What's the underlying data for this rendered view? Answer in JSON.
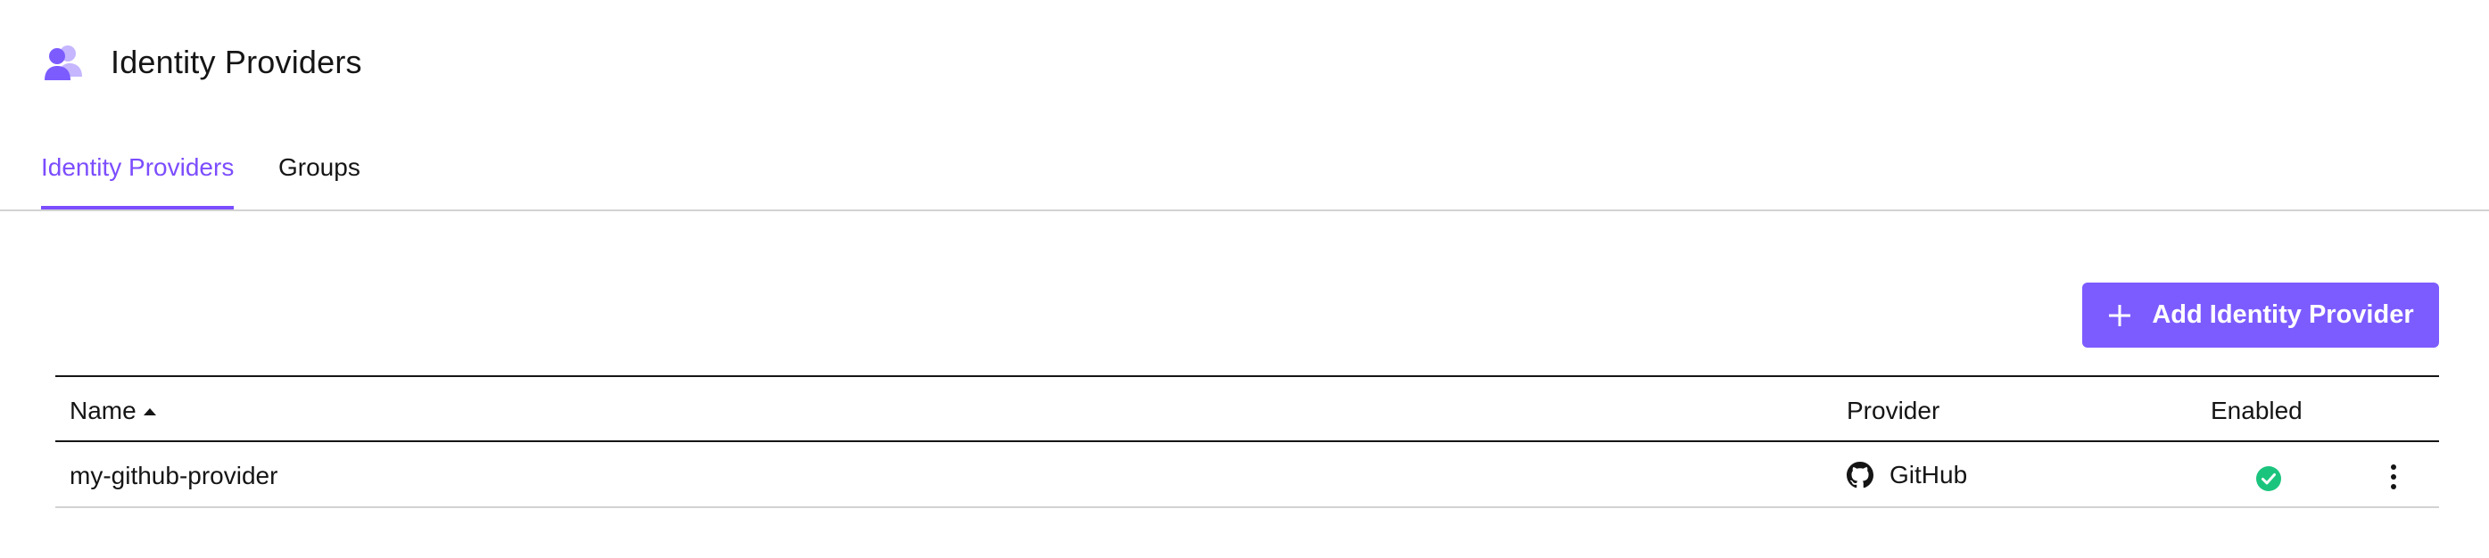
{
  "header": {
    "title": "Identity Providers",
    "icon": "users-icon",
    "icon_color": "#7c5cff"
  },
  "tabs": [
    {
      "label": "Identity Providers",
      "active": true
    },
    {
      "label": "Groups",
      "active": false
    }
  ],
  "toolbar": {
    "add_label": "Add Identity Provider",
    "add_icon": "plus-icon",
    "accent": "#7c5cff"
  },
  "table": {
    "columns": {
      "name": "Name",
      "provider": "Provider",
      "enabled": "Enabled"
    },
    "sort": {
      "column": "Name",
      "direction": "ascending"
    },
    "rows": [
      {
        "name": "my-github-provider",
        "provider": "GitHub",
        "provider_icon": "github-icon",
        "enabled": true,
        "enabled_icon": "check-circle-icon",
        "enabled_color": "#1bc47d",
        "actions_icon": "kebab-menu-icon"
      }
    ]
  }
}
